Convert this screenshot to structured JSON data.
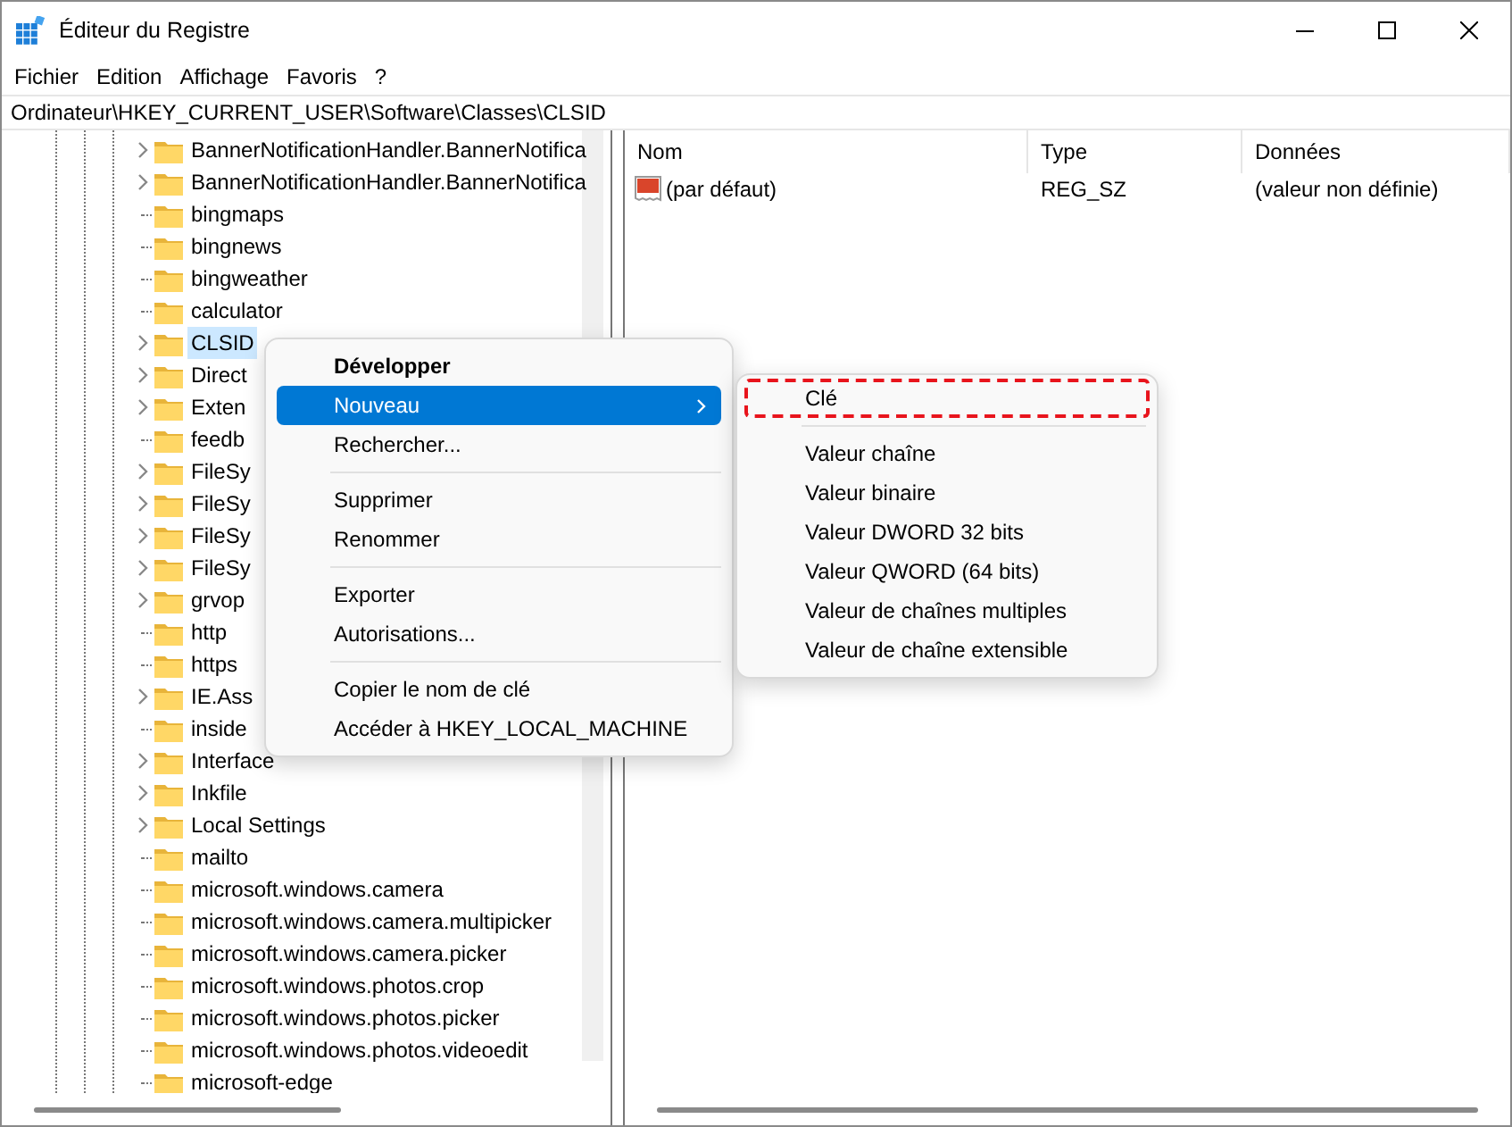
{
  "window": {
    "title": "Éditeur du Registre"
  },
  "menu_bar": [
    "Fichier",
    "Edition",
    "Affichage",
    "Favoris",
    "?"
  ],
  "address": "Ordinateur\\HKEY_CURRENT_USER\\Software\\Classes\\CLSID",
  "tree": [
    {
      "label": "BannerNotificationHandler.BannerNotifica",
      "expandable": true,
      "selected": false
    },
    {
      "label": "BannerNotificationHandler.BannerNotifica",
      "expandable": true,
      "selected": false
    },
    {
      "label": "bingmaps",
      "expandable": false,
      "selected": false
    },
    {
      "label": "bingnews",
      "expandable": false,
      "selected": false
    },
    {
      "label": "bingweather",
      "expandable": false,
      "selected": false
    },
    {
      "label": "calculator",
      "expandable": false,
      "selected": false
    },
    {
      "label": "CLSID",
      "expandable": true,
      "selected": true
    },
    {
      "label": "Direct",
      "expandable": true,
      "selected": false
    },
    {
      "label": "Exten",
      "expandable": true,
      "selected": false
    },
    {
      "label": "feedb",
      "expandable": false,
      "selected": false
    },
    {
      "label": "FileSy",
      "expandable": true,
      "selected": false
    },
    {
      "label": "FileSy",
      "expandable": true,
      "selected": false
    },
    {
      "label": "FileSy",
      "expandable": true,
      "selected": false
    },
    {
      "label": "FileSy",
      "expandable": true,
      "selected": false
    },
    {
      "label": "grvop",
      "expandable": true,
      "selected": false
    },
    {
      "label": "http",
      "expandable": false,
      "selected": false
    },
    {
      "label": "https",
      "expandable": false,
      "selected": false
    },
    {
      "label": "IE.Ass",
      "expandable": true,
      "selected": false
    },
    {
      "label": "inside",
      "expandable": false,
      "selected": false
    },
    {
      "label": "Interface",
      "expandable": true,
      "selected": false
    },
    {
      "label": "Inkfile",
      "expandable": true,
      "selected": false
    },
    {
      "label": "Local Settings",
      "expandable": true,
      "selected": false
    },
    {
      "label": "mailto",
      "expandable": false,
      "selected": false
    },
    {
      "label": "microsoft.windows.camera",
      "expandable": false,
      "selected": false
    },
    {
      "label": "microsoft.windows.camera.multipicker",
      "expandable": false,
      "selected": false
    },
    {
      "label": "microsoft.windows.camera.picker",
      "expandable": false,
      "selected": false
    },
    {
      "label": "microsoft.windows.photos.crop",
      "expandable": false,
      "selected": false
    },
    {
      "label": "microsoft.windows.photos.picker",
      "expandable": false,
      "selected": false
    },
    {
      "label": "microsoft.windows.photos.videoedit",
      "expandable": false,
      "selected": false
    },
    {
      "label": "microsoft-edge",
      "expandable": false,
      "selected": false
    }
  ],
  "values": {
    "columns": [
      "Nom",
      "Type",
      "Données"
    ],
    "rows": [
      {
        "name": "(par défaut)",
        "type": "REG_SZ",
        "data": "(valeur non définie)"
      }
    ]
  },
  "context_menu": [
    {
      "kind": "item",
      "label": "Développer",
      "default": true,
      "selected": false
    },
    {
      "kind": "item",
      "label": "Nouveau",
      "default": false,
      "selected": true,
      "submenu": true
    },
    {
      "kind": "item",
      "label": "Rechercher...",
      "default": false,
      "selected": false
    },
    {
      "kind": "separator"
    },
    {
      "kind": "item",
      "label": "Supprimer",
      "default": false,
      "selected": false
    },
    {
      "kind": "item",
      "label": "Renommer",
      "default": false,
      "selected": false
    },
    {
      "kind": "separator"
    },
    {
      "kind": "item",
      "label": "Exporter",
      "default": false,
      "selected": false
    },
    {
      "kind": "item",
      "label": "Autorisations...",
      "default": false,
      "selected": false
    },
    {
      "kind": "separator"
    },
    {
      "kind": "item",
      "label": "Copier le nom de clé",
      "default": false,
      "selected": false
    },
    {
      "kind": "item",
      "label": "Accéder à HKEY_LOCAL_MACHINE",
      "default": false,
      "selected": false
    }
  ],
  "submenu": [
    {
      "kind": "item",
      "label": "Clé",
      "highlighted": true
    },
    {
      "kind": "separator"
    },
    {
      "kind": "item",
      "label": "Valeur chaîne",
      "highlighted": false
    },
    {
      "kind": "item",
      "label": "Valeur binaire",
      "highlighted": false
    },
    {
      "kind": "item",
      "label": "Valeur DWORD 32 bits",
      "highlighted": false
    },
    {
      "kind": "item",
      "label": "Valeur QWORD (64 bits)",
      "highlighted": false
    },
    {
      "kind": "item",
      "label": "Valeur de chaînes multiples",
      "highlighted": false
    },
    {
      "kind": "item",
      "label": "Valeur de chaîne extensible",
      "highlighted": false
    }
  ]
}
